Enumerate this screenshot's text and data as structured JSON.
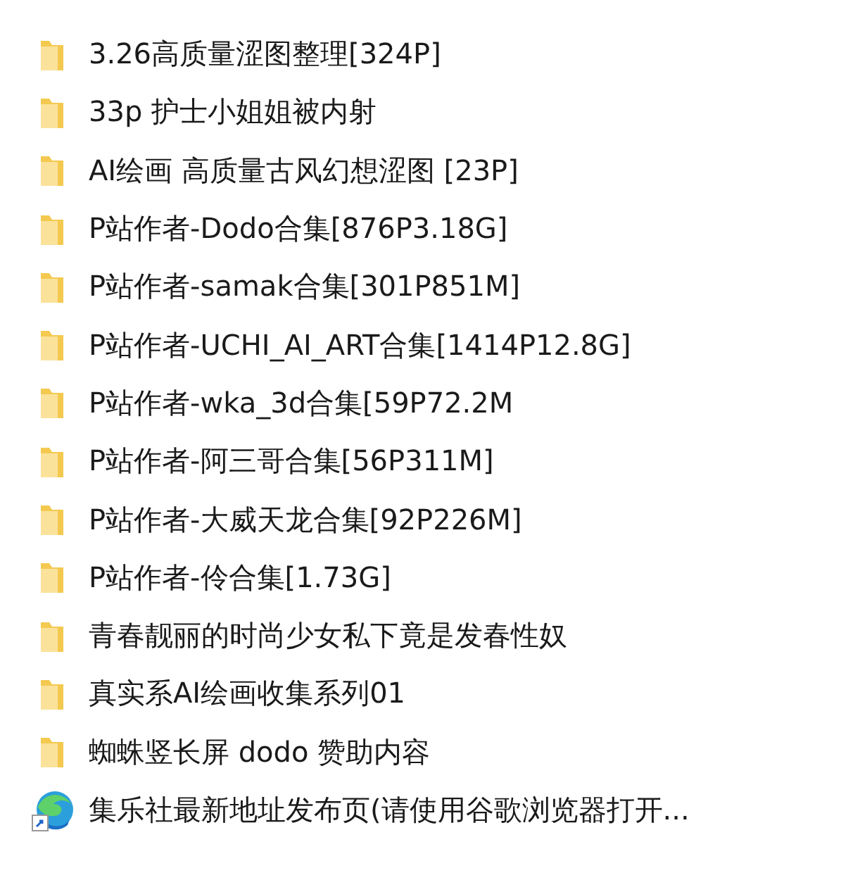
{
  "items": [
    {
      "kind": "folder",
      "name": "3.26高质量涩图整理[324P]"
    },
    {
      "kind": "folder",
      "name": "33p 护士小姐姐被内射"
    },
    {
      "kind": "folder",
      "name": "AI绘画 高质量古风幻想涩图 [23P]"
    },
    {
      "kind": "folder",
      "name": "P站作者-Dodo合集[876P3.18G]"
    },
    {
      "kind": "folder",
      "name": "P站作者-samak合集[301P851M]"
    },
    {
      "kind": "folder",
      "name": "P站作者-UCHI_AI_ART合集[1414P12.8G]"
    },
    {
      "kind": "folder",
      "name": "P站作者-wka_3d合集[59P72.2M"
    },
    {
      "kind": "folder",
      "name": "P站作者-阿三哥合集[56P311M]"
    },
    {
      "kind": "folder",
      "name": "P站作者-大威天龙合集[92P226M]"
    },
    {
      "kind": "folder",
      "name": "P站作者-伶合集[1.73G]"
    },
    {
      "kind": "folder",
      "name": "青春靓丽的时尚少女私下竟是发春性奴"
    },
    {
      "kind": "folder",
      "name": "真实系AI绘画收集系列01"
    },
    {
      "kind": "folder",
      "name": "蜘蛛竖长屏 dodo 赞助内容"
    },
    {
      "kind": "shortcut",
      "name": "集乐社最新地址发布页(请使用谷歌浏览器打开..."
    }
  ]
}
